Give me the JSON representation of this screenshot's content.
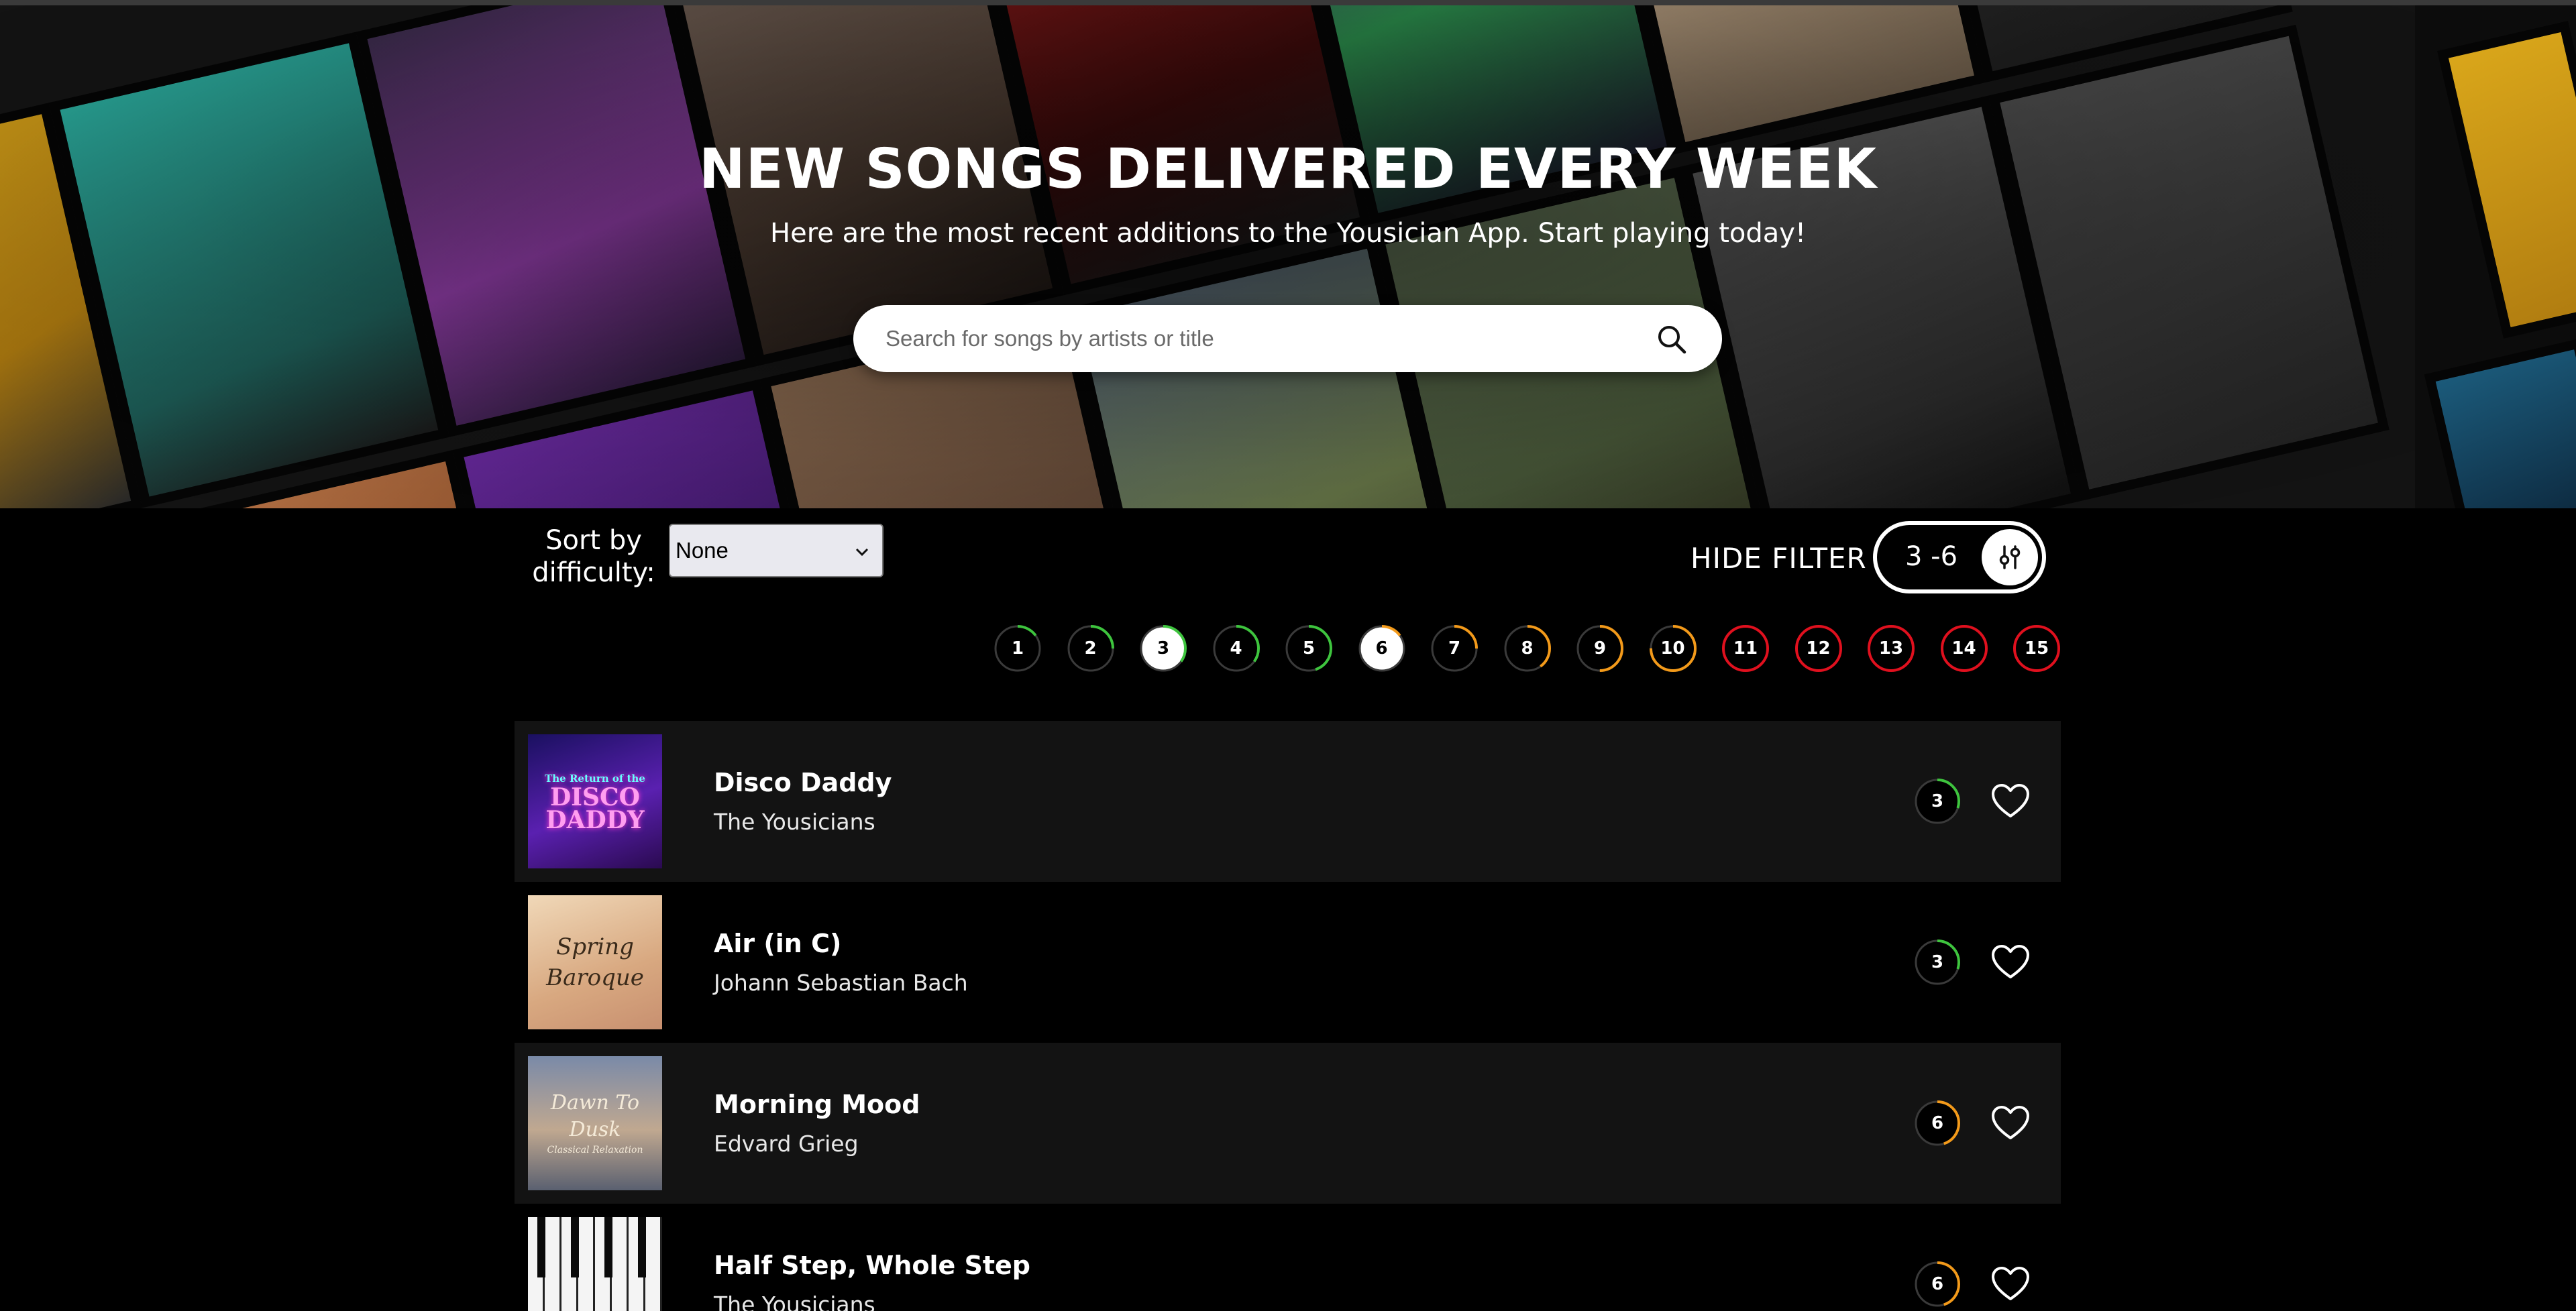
{
  "hero": {
    "title": "NEW SONGS DELIVERED EVERY WEEK",
    "subtitle": "Here are the most recent additions to the Yousician App. Start playing today!"
  },
  "search": {
    "placeholder": "Search for songs by artists or title",
    "icon": "search-icon"
  },
  "sort": {
    "label": "Sort by difficulty:",
    "selected": "None"
  },
  "filter": {
    "toggle_label": "HIDE FILTER",
    "range": "3 -6",
    "icon": "sliders-icon"
  },
  "levels": [
    {
      "label": "1",
      "selected": false,
      "color": "#3ec43e",
      "fill": 0.15
    },
    {
      "label": "2",
      "selected": false,
      "color": "#3ec43e",
      "fill": 0.25
    },
    {
      "label": "3",
      "selected": true,
      "color": "#3ec43e",
      "fill": 0.35
    },
    {
      "label": "4",
      "selected": false,
      "color": "#3ec43e",
      "fill": 0.35
    },
    {
      "label": "5",
      "selected": false,
      "color": "#3ec43e",
      "fill": 0.45
    },
    {
      "label": "6",
      "selected": true,
      "color": "#f39a1a",
      "fill": 0.15
    },
    {
      "label": "7",
      "selected": false,
      "color": "#f39a1a",
      "fill": 0.25
    },
    {
      "label": "8",
      "selected": false,
      "color": "#f39a1a",
      "fill": 0.4
    },
    {
      "label": "9",
      "selected": false,
      "color": "#f39a1a",
      "fill": 0.5
    },
    {
      "label": "10",
      "selected": false,
      "color": "#f39a1a",
      "fill": 0.75
    },
    {
      "label": "11",
      "selected": false,
      "color": "#e0101e",
      "fill": 1
    },
    {
      "label": "12",
      "selected": false,
      "color": "#e0101e",
      "fill": 1
    },
    {
      "label": "13",
      "selected": false,
      "color": "#e0101e",
      "fill": 1
    },
    {
      "label": "14",
      "selected": false,
      "color": "#e0101e",
      "fill": 1
    },
    {
      "label": "15",
      "selected": false,
      "color": "#e0101e",
      "fill": 1
    }
  ],
  "songs": [
    {
      "title": "Disco Daddy",
      "artist": "The Yousicians",
      "level": "3",
      "level_color": "#3ec43e",
      "level_fill": 0.3,
      "art_text": [
        "The Return of the",
        "DISCO",
        "DADDY"
      ],
      "art_bg": "#3a1a8a"
    },
    {
      "title": "Air (in C)",
      "artist": "Johann Sebastian Bach",
      "level": "3",
      "level_color": "#3ec43e",
      "level_fill": 0.3,
      "art_text": [
        "Spring",
        "Baroque"
      ],
      "art_bg": "#e8c9a0"
    },
    {
      "title": "Morning Mood",
      "artist": "Edvard Grieg",
      "level": "6",
      "level_color": "#f39a1a",
      "level_fill": 0.45,
      "art_text": [
        "Dawn To Dusk",
        "Classical Relaxation"
      ],
      "art_bg": "#7f8aa0"
    },
    {
      "title": "Half Step, Whole Step",
      "artist": "The Yousicians",
      "level": "6",
      "level_color": "#f39a1a",
      "level_fill": 0.45,
      "art_text": [],
      "art_bg": "#151515"
    }
  ]
}
